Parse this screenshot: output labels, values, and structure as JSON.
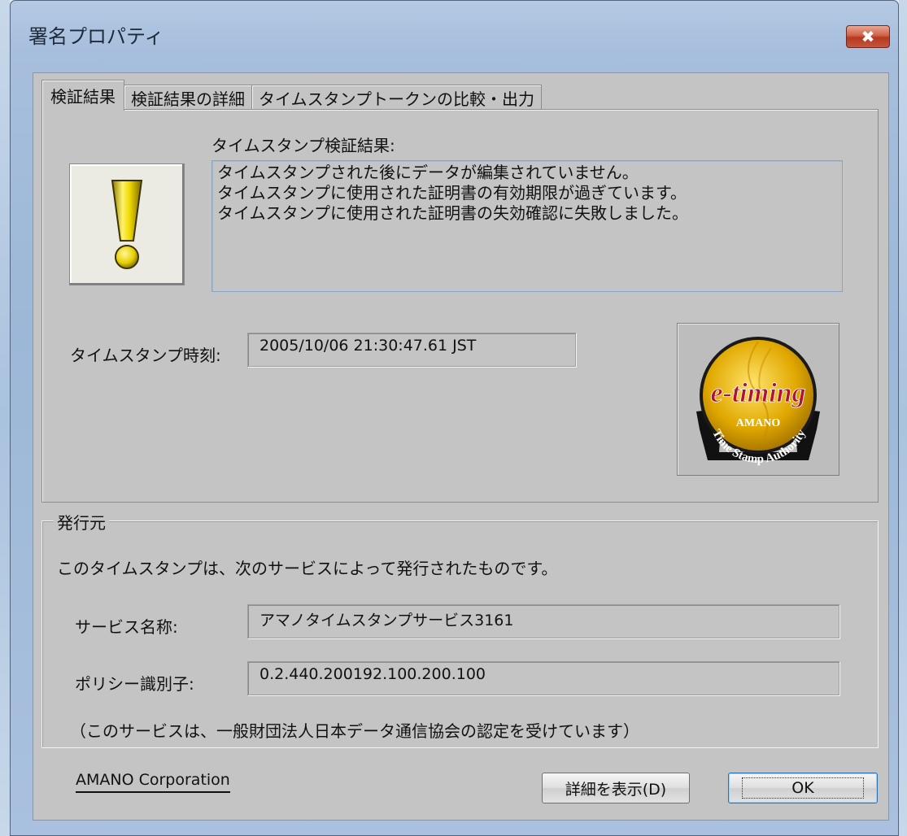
{
  "window": {
    "title": "署名プロパティ",
    "close_symbol": "✖"
  },
  "tabs": [
    {
      "label": "検証結果",
      "active": true
    },
    {
      "label": "検証結果の詳細",
      "active": false
    },
    {
      "label": "タイムスタンプトークンの比較・出力",
      "active": false
    }
  ],
  "verification": {
    "heading": "タイムスタンプ検証結果:",
    "status_icon": "warning-exclamation-icon",
    "results": [
      "タイムスタンプされた後にデータが編集されていません。",
      "タイムスタンプに使用された証明書の有効期限が過ぎています。",
      "タイムスタンプに使用された証明書の失効確認に失敗しました。"
    ],
    "time_label": "タイムスタンプ時刻:",
    "time_value": "2005/10/06 21:30:47.61 JST",
    "logo": {
      "main": "e-timing",
      "maker": "AMANO",
      "ring_text": "Time Stamp Authority"
    }
  },
  "issuer": {
    "group_title": "発行元",
    "description": "このタイムスタンプは、次のサービスによって発行されたものです。",
    "service_label": "サービス名称:",
    "service_value": "アマノタイムスタンプサービス3161",
    "policy_label": "ポリシー識別子:",
    "policy_value": "0.2.440.200192.100.200.100",
    "note": "（このサービスは、一般財団法人日本データ通信協会の認定を受けています）"
  },
  "footer": {
    "company_link": "AMANO Corporation",
    "details_button": "詳細を表示(D)",
    "ok_button": "OK"
  },
  "colors": {
    "title_glass": "#a7bfdd",
    "dialog_face": "#c4c4c4",
    "close_red": "#c8543b",
    "logo_gold": "#e0a800"
  }
}
